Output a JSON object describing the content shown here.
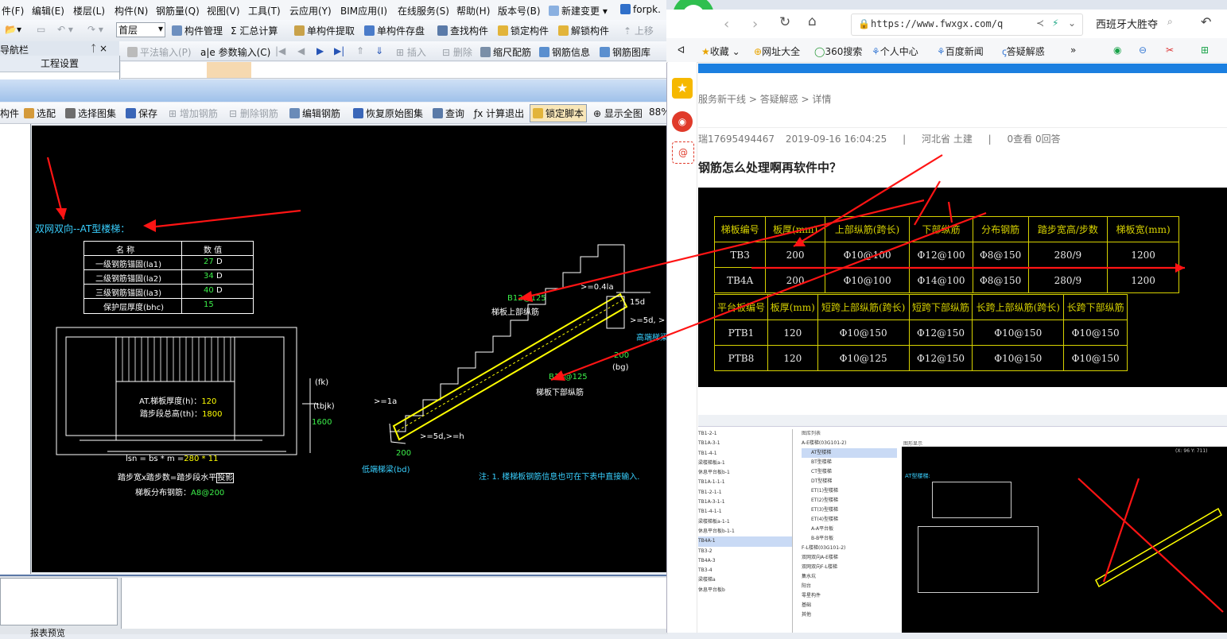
{
  "cad_app": {
    "menu": [
      "件(F)",
      "编辑(E)",
      "楼层(L)",
      "构件(N)",
      "钢筋量(Q)",
      "视图(V)",
      "工具(T)",
      "云应用(Y)",
      "BIM应用(I)",
      "在线服务(S)",
      "帮助(H)",
      "版本号(B)",
      "新建变更",
      "forpk."
    ],
    "floor_select": "首层",
    "toolbar1": [
      "构件管理",
      "Σ 汇总计算",
      "单构件提取",
      "单构件存盘",
      "查找构件",
      "锁定构件",
      "解锁构件",
      "上移"
    ],
    "toolbar2": [
      "平法输入(P)",
      "参数输入(C)",
      "插入",
      "删除",
      "缩尺配筋",
      "钢筋信息",
      "钢筋图库"
    ],
    "nav_title": "导航栏",
    "nav_pin": "ᛏ ×",
    "nav_item": "工程设置",
    "toolbar3": [
      "构件",
      "选配",
      "选择图集",
      "保存",
      "增加钢筋",
      "删除钢筋",
      "编辑钢筋",
      "恢复原始图集",
      "查询",
      "计算退出",
      "锁定脚本",
      "显示全图",
      "88%"
    ],
    "bottom_label": "报表预览"
  },
  "cad_drawing": {
    "title": "双网双向--AT型楼梯：",
    "table_header": [
      "名 称",
      "数 值"
    ],
    "table_rows": [
      {
        "name": "一级钢筋锚固(la1)",
        "value": "27",
        "unit": "D"
      },
      {
        "name": "二级钢筋锚固(la2)",
        "value": "34",
        "unit": "D"
      },
      {
        "name": "三级钢筋锚固(la3)",
        "value": "40",
        "unit": "D"
      },
      {
        "name": "保护层厚度(bhc)",
        "value": "15",
        "unit": ""
      }
    ],
    "thickness_label": "AT.梯板厚度(h)：",
    "thickness_value": "120",
    "height_label": "踏步段总高(th)：",
    "height_value": "1800",
    "ln_label": "lsn = bs * m =",
    "ln_value": "280 * 11",
    "step_desc_a": "踏步宽x踏步数=踏步段水平",
    "step_desc_b": "投影",
    "dist_label": "梯板分布钢筋：",
    "dist_value": "A8@200",
    "fk": "(fk)",
    "tbjk": "(tbjk)",
    "tbjk_value": "1600",
    "upper_bar_value": "B12@125",
    "upper_bar_label": "梯板上部纵筋",
    "lower_bar_value": "B12@125",
    "lower_bar_label": "梯板下部纵筋",
    "high_beam": "高端梯梁",
    "low_beam": "低端梯梁(bd)",
    "dim_04la": ">=0.4la",
    "dim_15d": "15d",
    "dim_5d": ">=5d, >",
    "dim_200_a": "200",
    "dim_bg": "(bg)",
    "dim_1a": ">=1a",
    "dim_5dh": ">=5d,>=h",
    "dim_200_b": "200",
    "note": "注: 1. 楼梯板钢筋信息也可在下表中直接输入."
  },
  "browser": {
    "tab_hint": "",
    "url": "https://www.fwxgx.com/q",
    "search_text": "西班牙大胜夺",
    "bookmarks": [
      "收藏",
      "网址大全",
      "360搜索",
      "个人中心",
      "百度新闻",
      "答疑解惑"
    ],
    "breadcrumb": [
      "服务新干线",
      "答疑解惑",
      "详情"
    ],
    "question_user": "瑞17695494467",
    "question_time": "2019-09-16 16:04:25",
    "question_region": "河北省",
    "question_category": "土建",
    "question_views": "0查看",
    "question_answers": "0回答",
    "question_title": "钢筋怎么处理啊再软件中？",
    "table_header_1": [
      "梯板编号",
      "板厚(mm)",
      "上部纵筋(跨长)",
      "下部纵筋",
      "分布钢筋",
      "踏步宽高/步数",
      "梯板宽(mm)"
    ],
    "table_rows_1": [
      [
        "TB3",
        "200",
        "Φ10@100",
        "Φ12@100",
        "Φ8@150",
        "280/9",
        "1200"
      ],
      [
        "TB4A",
        "200",
        "Φ10@100",
        "Φ14@100",
        "Φ8@150",
        "280/9",
        "1200"
      ]
    ],
    "table_header_2": [
      "平台板编号",
      "板厚(mm)",
      "短跨上部纵筋(跨长)",
      "短跨下部纵筋",
      "长跨上部纵筋(跨长)",
      "长跨下部纵筋"
    ],
    "table_rows_2": [
      [
        "PTB1",
        "120",
        "Φ10@150",
        "Φ12@150",
        "Φ10@150",
        "Φ10@150"
      ],
      [
        "PTB8",
        "120",
        "Φ10@125",
        "Φ12@150",
        "Φ10@150",
        "Φ10@150"
      ]
    ],
    "thumb_list": [
      "TB1-2-1",
      "TB1A-3-1",
      "TB1-4-1",
      "梁楼梯板a-1",
      "休息平台板b-1",
      "TB1A-1-1-1",
      "TB1-2-1-1",
      "TB1A-3-1-1",
      "TB1-4-1-1",
      "梁楼梯板a-1-1",
      "休息平台板b-1-1",
      "TB4A-1",
      "TB3-2",
      "TB4A-3",
      "TB3-4",
      "梁楼梯a",
      "休息平台板b"
    ],
    "thumb_tree": [
      "A-E楼梯(03G101-2)",
      "AT型楼梯",
      "BT型楼梯",
      "CT型楼梯",
      "DT型楼梯",
      "ET(1)型楼梯",
      "ET(2)型楼梯",
      "ET(3)型楼梯",
      "ET(4)型楼梯",
      "A-A平台板",
      "B-B平台板",
      "F-L楼梯(03G101-2)",
      "双网双向A-E楼梯",
      "双网双向F-L楼梯",
      "集水坑",
      "阳台",
      "零星构件",
      "基础",
      "其他"
    ],
    "thumb_coords": "(X: 96 Y: 711)",
    "thumb_title": "AT型楼梯:",
    "thumb_col_a": "图库列表",
    "thumb_col_b": "图形显示"
  },
  "colors": {
    "cad_bg": "#000000",
    "cad_text": "#ffffff",
    "cad_cyan": "#39d0ff",
    "cad_green": "#3cf04a",
    "cad_yellow": "#ffff00",
    "arrow": "#ff1414",
    "accent_blue": "#1b7fe0"
  }
}
